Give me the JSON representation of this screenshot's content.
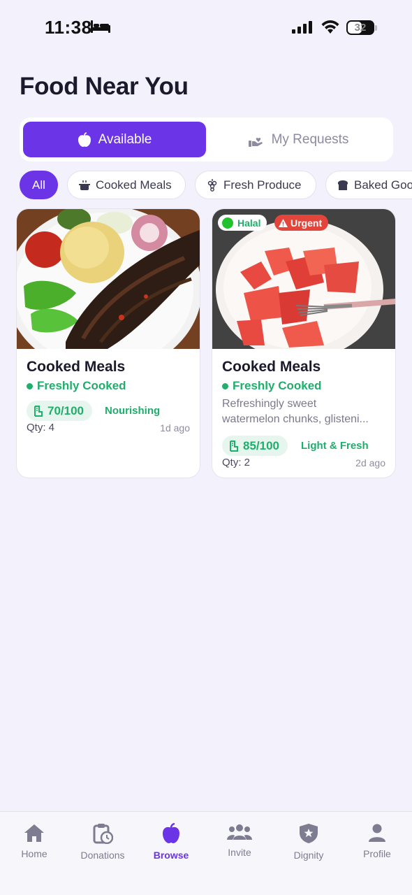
{
  "status_bar": {
    "time": "11:38",
    "battery": "32"
  },
  "page_title": "Food Near You",
  "segments": {
    "available": "Available",
    "my_requests": "My Requests"
  },
  "filters": [
    "All",
    "Cooked Meals",
    "Fresh Produce",
    "Baked Goods"
  ],
  "cards": [
    {
      "title": "Cooked Meals",
      "status": "Freshly Cooked",
      "description_lines": [],
      "score": "70/100",
      "score_label": "Nourishing",
      "quantity": "Qty: 4",
      "posted": "1d ago",
      "badges": []
    },
    {
      "title": "Cooked Meals",
      "status": "Freshly Cooked",
      "description_lines": [
        "Refreshingly sweet",
        "watermelon chunks, glisteni..."
      ],
      "score": "85/100",
      "score_label": "Light & Fresh",
      "quantity": "Qty: 2",
      "posted": "2d ago",
      "badges": [
        "Halal",
        "Urgent"
      ]
    }
  ],
  "nav": [
    "Home",
    "Donations",
    "Browse",
    "Invite",
    "Dignity",
    "Profile"
  ],
  "colors": {
    "accent": "#6b34e6",
    "success": "#1fae6c",
    "urgent": "#e4453b",
    "background": "#f3f1fb"
  }
}
